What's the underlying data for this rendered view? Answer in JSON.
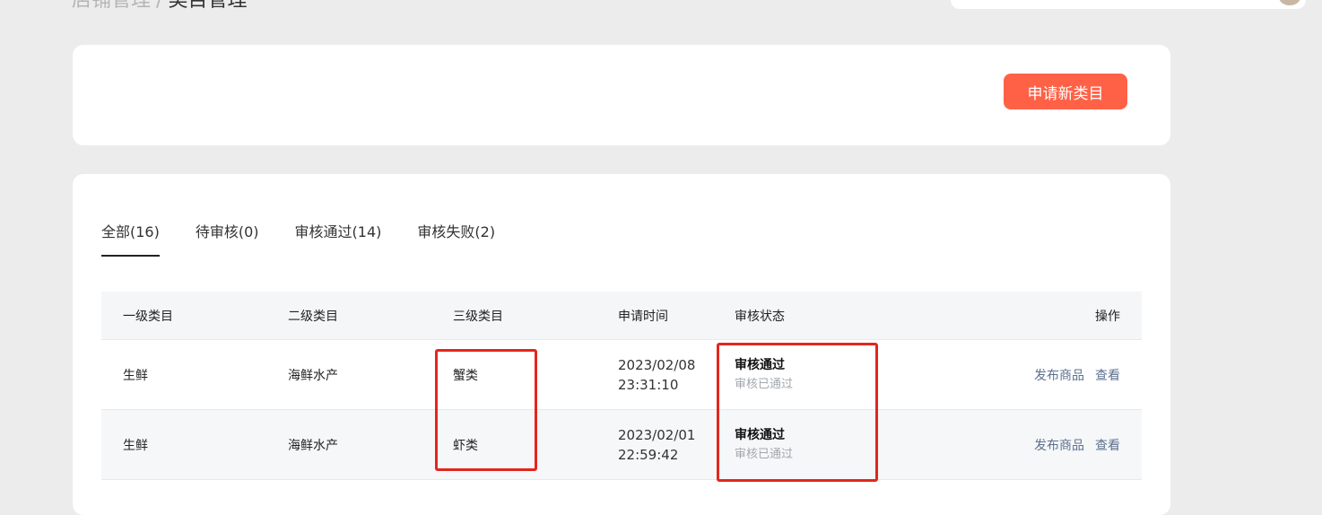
{
  "breadcrumb": {
    "parent": "店铺管理",
    "separator": "/",
    "current": "类目管理"
  },
  "header": {
    "apply_label": "申请新类目"
  },
  "tabs": [
    {
      "label": "全部(16)",
      "active": true
    },
    {
      "label": "待审核(0)",
      "active": false
    },
    {
      "label": "审核通过(14)",
      "active": false
    },
    {
      "label": "审核失败(2)",
      "active": false
    }
  ],
  "table": {
    "columns": [
      "一级类目",
      "二级类目",
      "三级类目",
      "申请时间",
      "审核状态",
      "操作"
    ],
    "rows": [
      {
        "level1": "生鲜",
        "level2": "海鲜水产",
        "level3": "蟹类",
        "date": "2023/02/08",
        "time": "23:31:10",
        "status": "审核通过",
        "status_detail": "审核已通过",
        "action_publish": "发布商品",
        "action_view": "查看"
      },
      {
        "level1": "生鲜",
        "level2": "海鲜水产",
        "level3": "虾类",
        "date": "2023/02/01",
        "time": "22:59:42",
        "status": "审核通过",
        "status_detail": "审核已通过",
        "action_publish": "发布商品",
        "action_view": "查看"
      }
    ]
  },
  "colors": {
    "accent": "#ff6147",
    "link": "#5d7190",
    "highlight": "#e3261c",
    "background": "#ececec"
  }
}
